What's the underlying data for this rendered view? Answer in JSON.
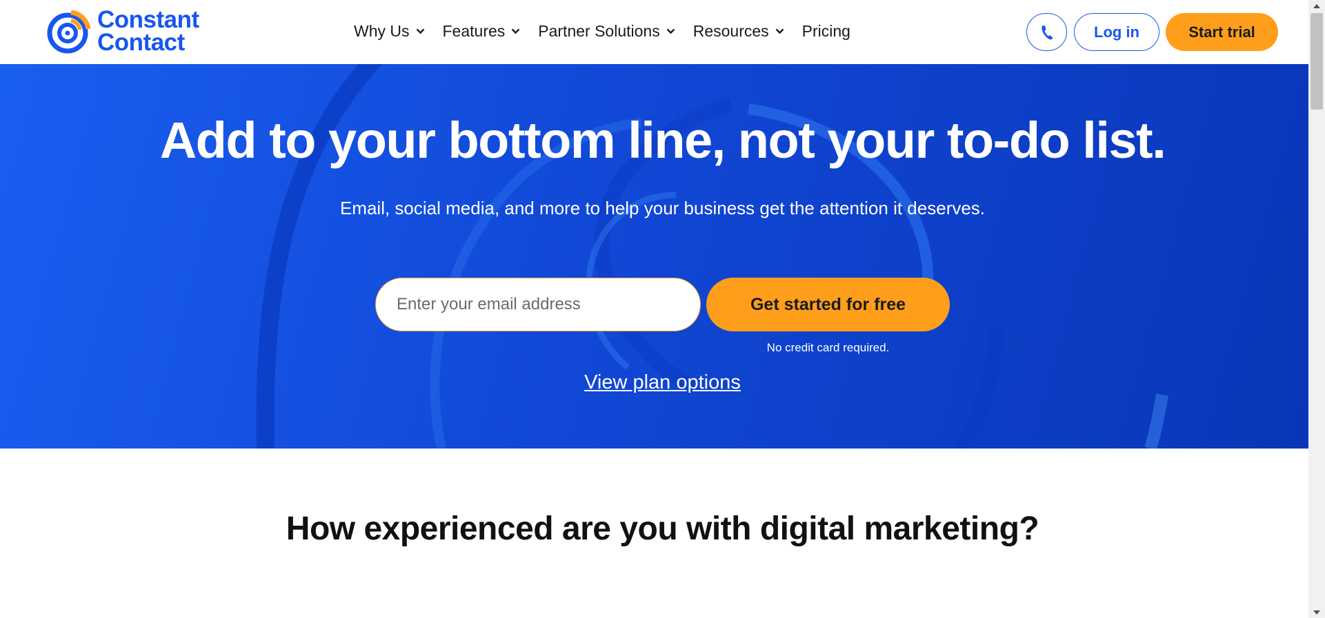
{
  "header": {
    "logo": {
      "line1": "Constant",
      "line2": "Contact",
      "icon": "constant-contact-logo"
    },
    "nav": [
      {
        "label": "Why Us",
        "has_dropdown": true
      },
      {
        "label": "Features",
        "has_dropdown": true
      },
      {
        "label": "Partner Solutions",
        "has_dropdown": true
      },
      {
        "label": "Resources",
        "has_dropdown": true
      },
      {
        "label": "Pricing",
        "has_dropdown": false
      }
    ],
    "phone_icon": "phone-icon",
    "login_label": "Log in",
    "trial_label": "Start trial"
  },
  "hero": {
    "title": "Add to your bottom line, not your to-do list.",
    "subtitle": "Email, social media, and more to help your business get the attention it deserves.",
    "email_placeholder": "Enter your email address",
    "cta_label": "Get started for free",
    "no_credit_card": "No credit card required.",
    "plan_link": "View plan options"
  },
  "section": {
    "title": "How experienced are you with digital marketing?"
  },
  "colors": {
    "brand_blue": "#1856ed",
    "hero_blue": "#1148d6",
    "cta_orange": "#ff9e1b"
  }
}
